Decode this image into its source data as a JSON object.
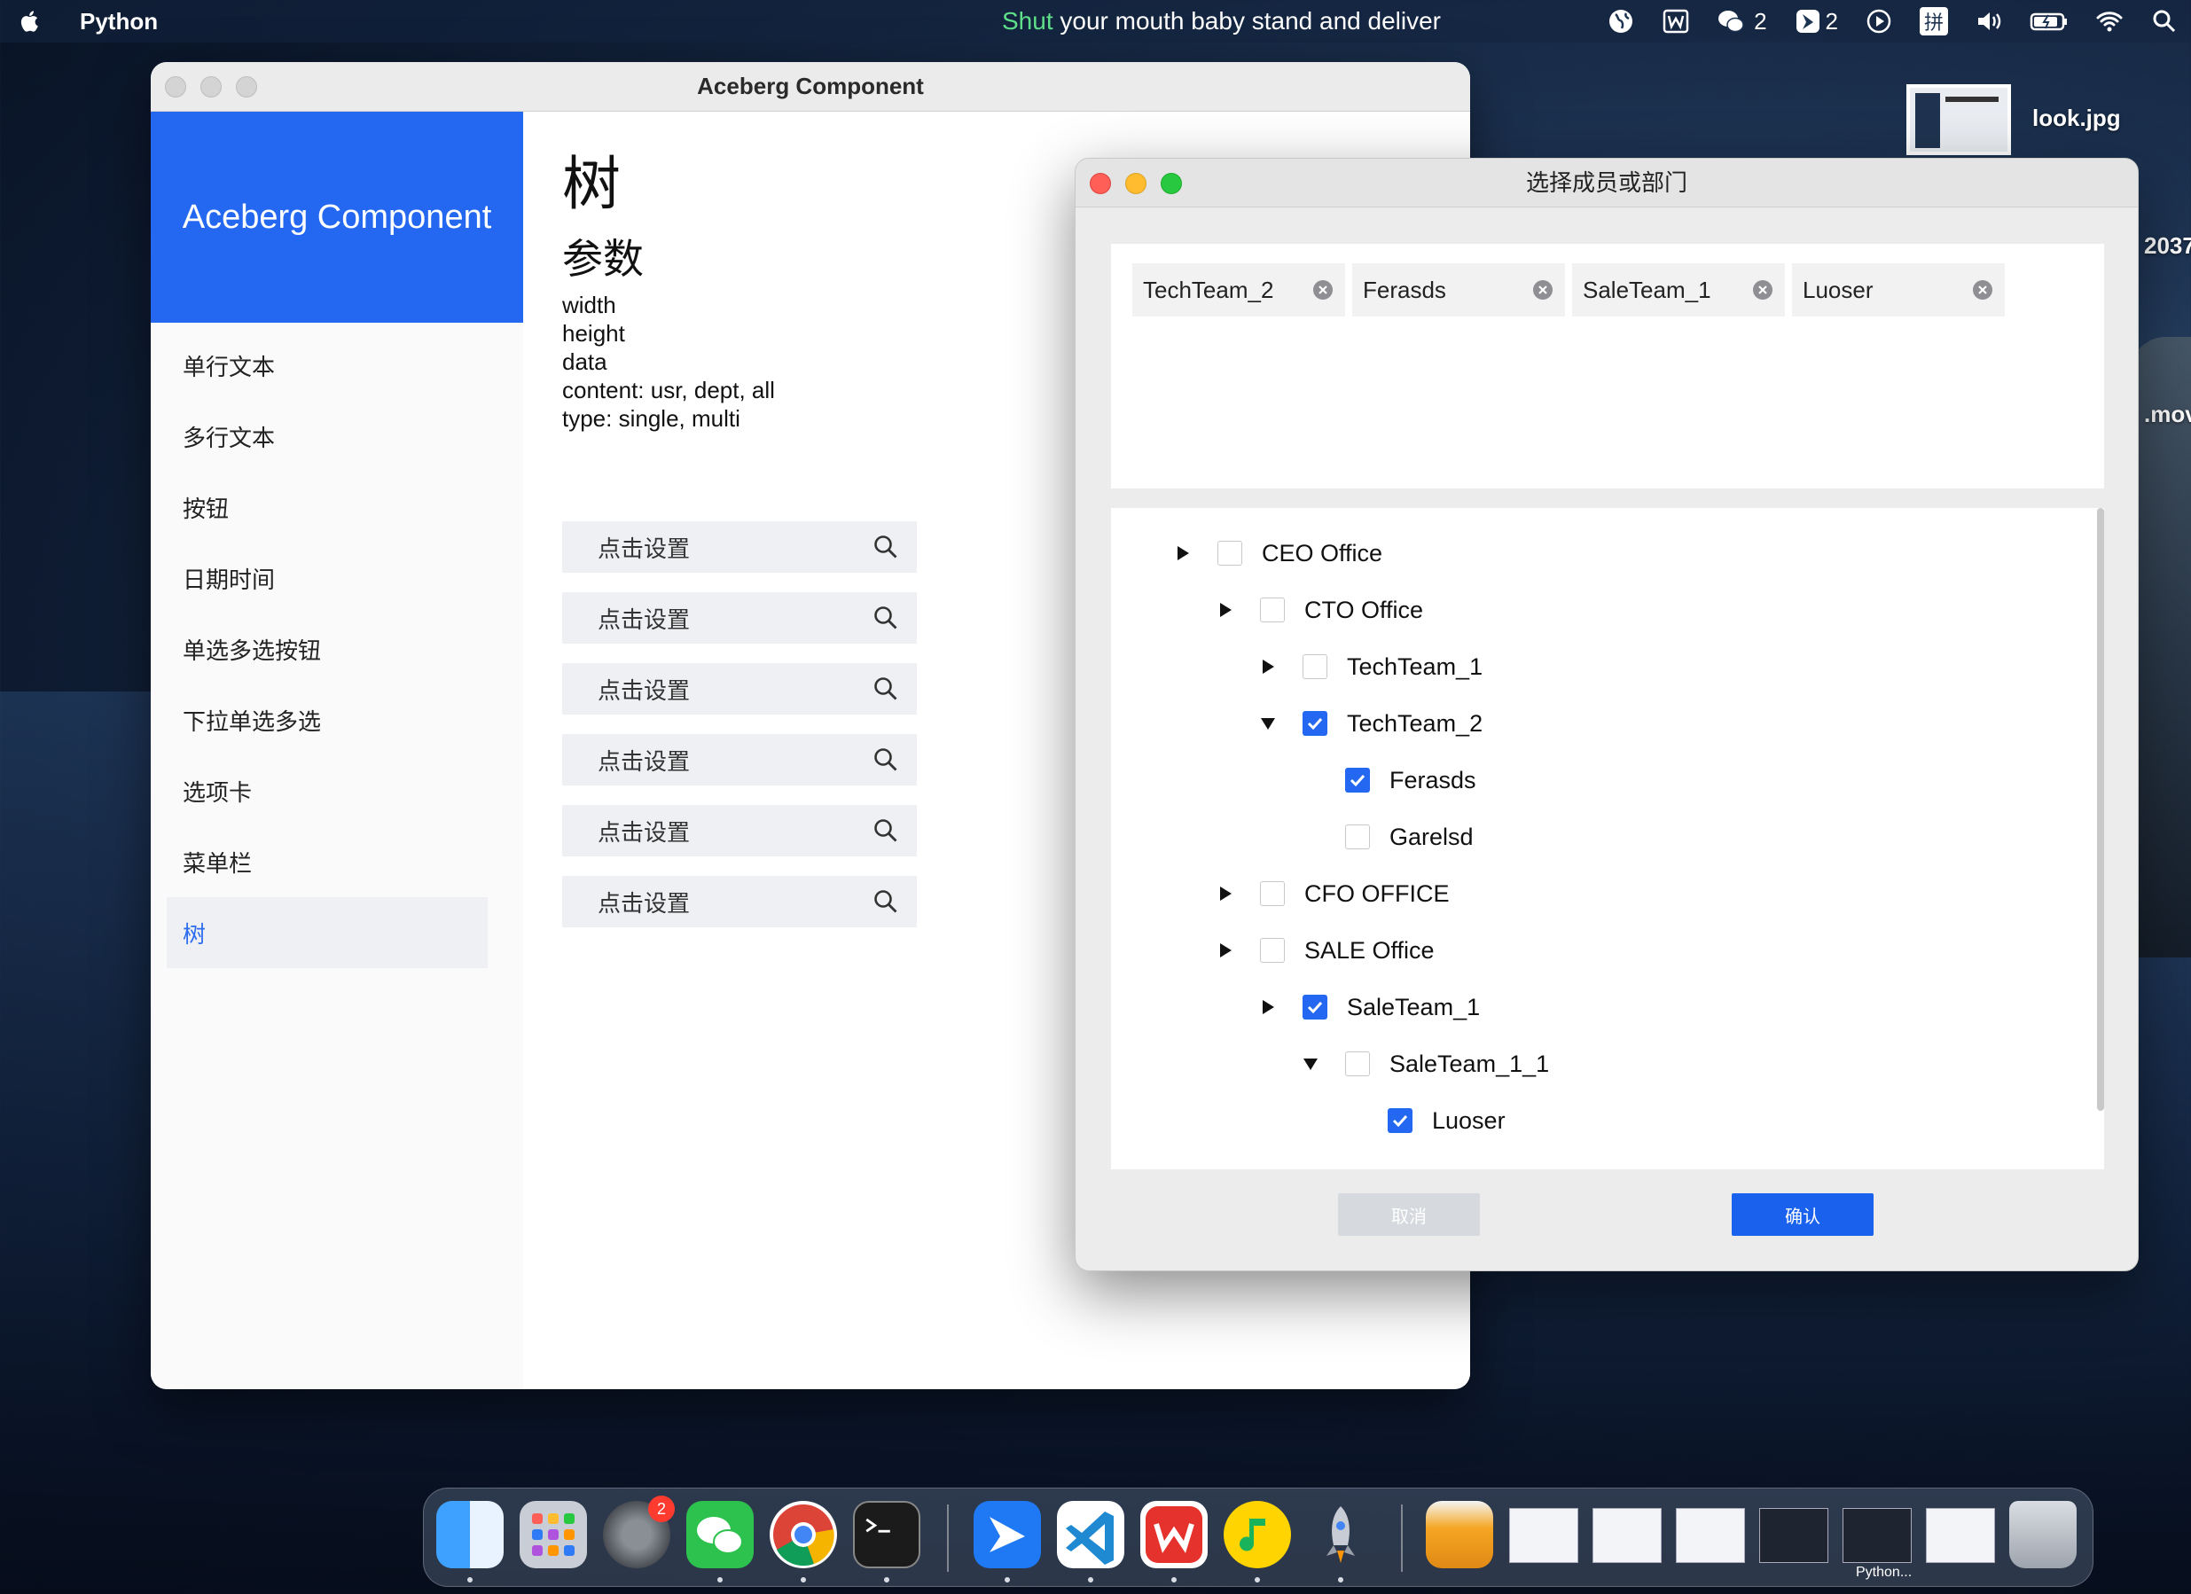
{
  "menubar": {
    "app_name": "Python",
    "lyrics_highlight": "Shut",
    "lyrics_rest": " your mouth baby stand and deliver",
    "wechat_count": "2",
    "feishu_count": "2",
    "input_method": "拼"
  },
  "desktop": {
    "file_label": "look.jpg",
    "edge_text_1": "2037",
    "edge_text_2": ".mov"
  },
  "main_window": {
    "title": "Aceberg Component",
    "sidebar_header": "Aceberg Component",
    "menu_items": [
      "单行文本",
      "多行文本",
      "按钮",
      "日期时间",
      "单选多选按钮",
      "下拉单选多选",
      "选项卡",
      "菜单栏",
      "树"
    ],
    "heading": "树",
    "subheading": "参数",
    "params": [
      "width",
      "height",
      "data",
      "content: usr, dept, all",
      "type: single, multi"
    ],
    "set_button_label": "点击设置"
  },
  "dialog": {
    "title": "选择成员或部门",
    "tags": [
      "TechTeam_2",
      "Ferasds",
      "SaleTeam_1",
      "Luoser"
    ],
    "tree": [
      {
        "label": "CEO Office",
        "arrow": "collapsed",
        "checked": false
      },
      {
        "label": "CTO Office",
        "arrow": "collapsed",
        "checked": false
      },
      {
        "label": "TechTeam_1",
        "arrow": "collapsed",
        "checked": false
      },
      {
        "label": "TechTeam_2",
        "arrow": "expanded",
        "checked": true
      },
      {
        "label": "Ferasds",
        "arrow": "none",
        "checked": true
      },
      {
        "label": "Garelsd",
        "arrow": "none",
        "checked": false
      },
      {
        "label": "CFO OFFICE",
        "arrow": "collapsed",
        "checked": false
      },
      {
        "label": "SALE Office",
        "arrow": "collapsed",
        "checked": false
      },
      {
        "label": "SaleTeam_1",
        "arrow": "collapsed",
        "checked": true
      },
      {
        "label": "SaleTeam_1_1",
        "arrow": "expanded",
        "checked": false
      },
      {
        "label": "Luoser",
        "arrow": "none",
        "checked": true
      }
    ],
    "cancel_label": "取消",
    "ok_label": "确认"
  },
  "dock": {
    "settings_badge": "2",
    "python_window_label": "Python..."
  },
  "colors": {
    "accent": "#2468f2",
    "ok_button": "#1a62ee",
    "cancel_button": "#d6d9dd",
    "lyrics_highlight": "#5fe08a"
  }
}
